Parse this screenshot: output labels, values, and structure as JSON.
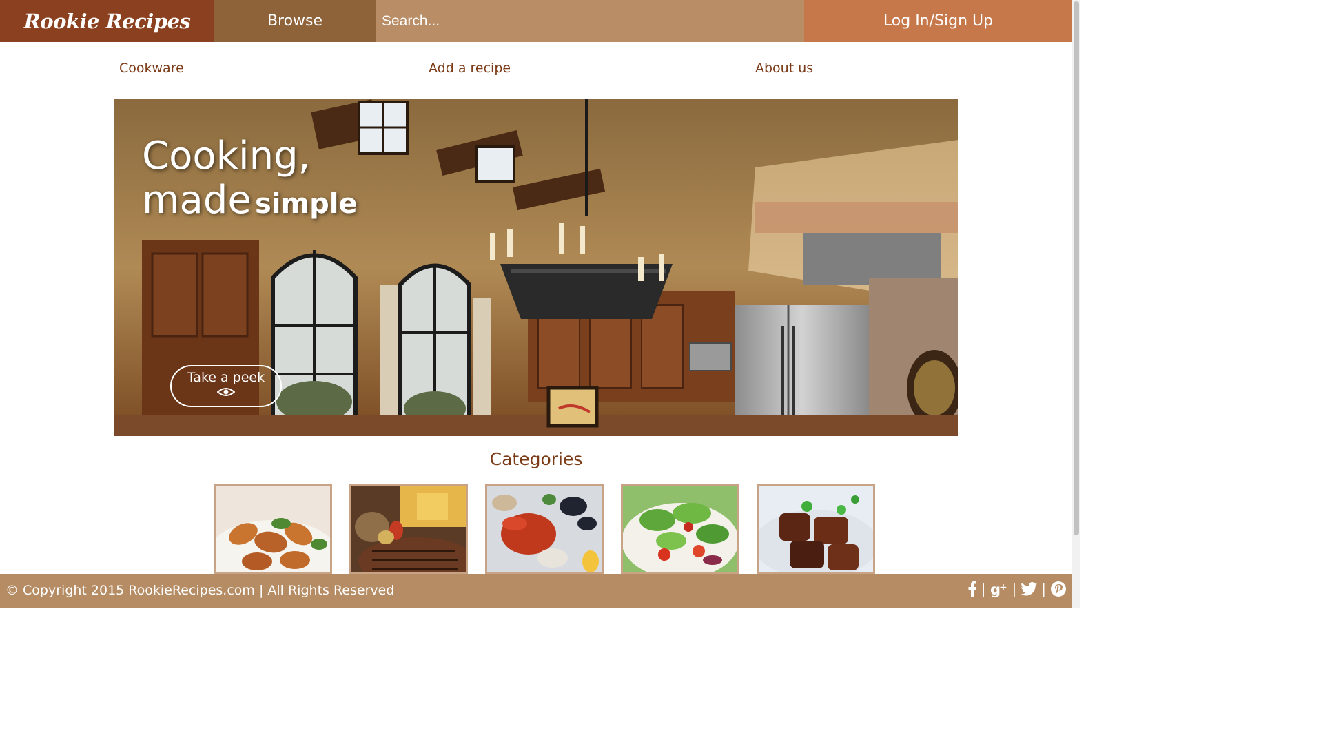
{
  "header": {
    "logo": "Rookie Recipes",
    "browse": "Browse",
    "search_placeholder": "Search...",
    "login": "Log In/Sign Up"
  },
  "subnav": {
    "items": [
      "Cookware",
      "Add a recipe",
      "About us"
    ]
  },
  "hero": {
    "line1": "Cooking,",
    "line2": "made",
    "line3": "simple",
    "cta": "Take a peek"
  },
  "categories": {
    "title": "Categories",
    "thumbs": [
      "chicken-drumsticks",
      "grilled-steak",
      "seafood-lobster",
      "green-salad",
      "braised-pork"
    ]
  },
  "footer": {
    "copyright": "© Copyright 2015 RookieRecipes.com | All Rights Reserved",
    "social": [
      "facebook-icon",
      "google-plus-icon",
      "twitter-icon",
      "pinterest-icon"
    ]
  },
  "colors": {
    "brand_dark": "#8b4120",
    "browse_bg": "#8e6339",
    "search_bg": "#b98e66",
    "login_bg": "#c7784a",
    "nav_text": "#7b3b16",
    "footer_bg": "#b58c63"
  }
}
